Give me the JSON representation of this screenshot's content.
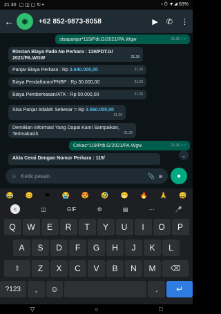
{
  "status_bar": {
    "time": "21.30",
    "left_icons": "▢ ◫ ▢ ↻ •",
    "right_text": "▫ ⏱ ▼◢ 63%"
  },
  "header": {
    "back_icon": "←",
    "avatar_text": "◉",
    "contact_name": "+62 852-9873-8058",
    "video_icon": "▶",
    "call_icon": "✆",
    "menu_icon": "⋮"
  },
  "messages": [
    {
      "type": "out",
      "text": "sisapanjar*119/Pdt.G/2021/PA.Wgw",
      "time": "21.26",
      "status": "✓✓"
    },
    {
      "type": "in",
      "text": "Rincian Biaya Pada No Perkara : 119/PDT.G/ 2021/PA.WGW",
      "time": "21.26"
    },
    {
      "type": "in",
      "prefix": "Panjar Biaya Perkara : Rp ",
      "amount": "3.640.000,00",
      "time": "21.26"
    },
    {
      "type": "in",
      "text": "Biaya Pendaftaran/PNBP : Rp 30.000,00",
      "time": "21.26"
    },
    {
      "type": "in",
      "text": "Biaya Pemberkasan/ATK : Rp 50.000,00",
      "time": "21.26"
    },
    {
      "type": "in",
      "prefix": "Sisa Panjar Adalah Sebesar = Rp ",
      "amount": "3.560.000,00",
      "time": "21.26"
    },
    {
      "type": "in",
      "text": "Demikian Informasi Yang Dapat Kami Sampaikan, Terimakasih",
      "time": "21.26"
    },
    {
      "type": "out",
      "text": "Cekac*119/Pdt.G/2021/PA.Wgw",
      "time": "21.26",
      "status": "✓✓"
    },
    {
      "type": "in",
      "text": "Akta Cerai Dengan Nomor Perkara : 119/",
      "time": ""
    }
  ],
  "composer": {
    "emoji_icon": "☺",
    "placeholder": "Ketik pesan",
    "attach_icon": "📎",
    "camera_icon": "◙",
    "mic_icon": "●",
    "scroll_icon": "⌄"
  },
  "emoji_bar": [
    "😂",
    "😊",
    "❤",
    "😭",
    "😍",
    "🤣",
    "😁",
    "🔥",
    "🙏",
    "😅"
  ],
  "keyboard_toolbar": [
    "<",
    "◫",
    "GIF",
    "⚙",
    "▤",
    "···",
    "🎤"
  ],
  "keyboard_rows": [
    [
      "Q",
      "W",
      "E",
      "R",
      "T",
      "Y",
      "U",
      "I",
      "O",
      "P"
    ],
    [
      "A",
      "S",
      "D",
      "F",
      "G",
      "H",
      "J",
      "K",
      "L"
    ],
    [
      "⇧",
      "Z",
      "X",
      "C",
      "V",
      "B",
      "N",
      "M",
      "⌫"
    ],
    [
      "?123",
      ",",
      "☺",
      "",
      ".",
      "↵"
    ]
  ],
  "nav_bar": [
    "▽",
    "○",
    "□"
  ]
}
